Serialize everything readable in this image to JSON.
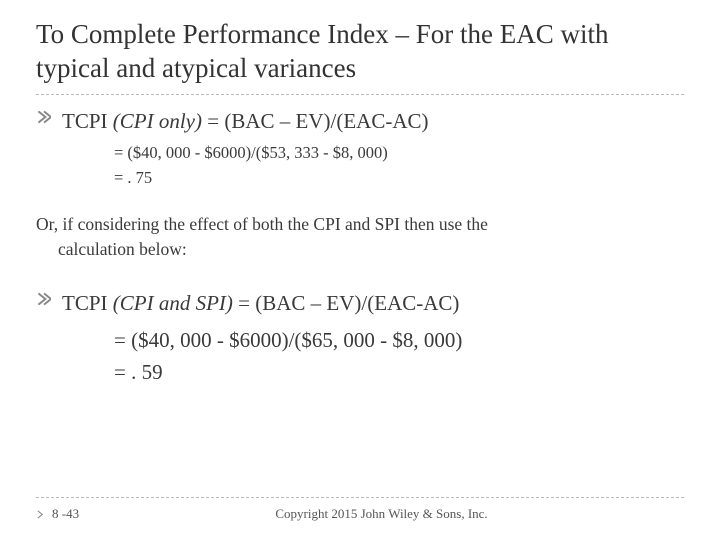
{
  "title": "To Complete Performance Index – For the EAC with typical and atypical variances",
  "bullets": {
    "b1": {
      "prefix": "TCPI",
      "paren": "(CPI only)",
      "rest": " = (BAC – EV)/(EAC-AC)"
    },
    "b2": {
      "prefix": "TCPI",
      "paren": "(CPI and SPI)",
      "rest": " = (BAC – EV)/(EAC-AC)"
    }
  },
  "calc1": {
    "line1": "= ($40, 000 - $6000)/($53, 333 - $8, 000)",
    "line2": "= . 75"
  },
  "mid": {
    "line1": "Or, if considering the effect of both the CPI and SPI then use the",
    "line2": "calculation below:"
  },
  "calc2": {
    "line1": "= ($40, 000 - $6000)/($65, 000 - $8, 000)",
    "line2": "= . 59"
  },
  "footer": {
    "page": "8 -43",
    "copyright": "Copyright 2015 John Wiley & Sons, Inc."
  }
}
